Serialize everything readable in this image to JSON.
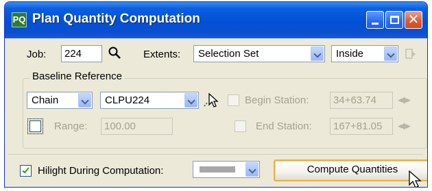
{
  "window": {
    "title": "Plan Quantity Computation",
    "app_icon_glyph": "PQ"
  },
  "job": {
    "label": "Job:",
    "value": "224",
    "search_icon": "magnifier-icon"
  },
  "extents": {
    "label": "Extents:",
    "value": "Selection Set",
    "mode": "Inside"
  },
  "baseline": {
    "group_title": "Baseline Reference",
    "type": "Chain",
    "name": "CLPU224",
    "begin_station_label": "Begin Station:",
    "begin_station_value": "34+63.74",
    "end_station_label": "End Station:",
    "end_station_value": "167+81.05",
    "range_label": "Range:",
    "range_value": "100.00"
  },
  "bottom": {
    "hilight_label": "Hilight During Computation:",
    "hilight_checked": true,
    "compute_label": "Compute Quantities",
    "hilight_color": "#a7a7a7"
  },
  "colors": {
    "titlebar": "#0350d6",
    "dialog_bg": "#ece9d8",
    "button_border": "#e9b048"
  }
}
